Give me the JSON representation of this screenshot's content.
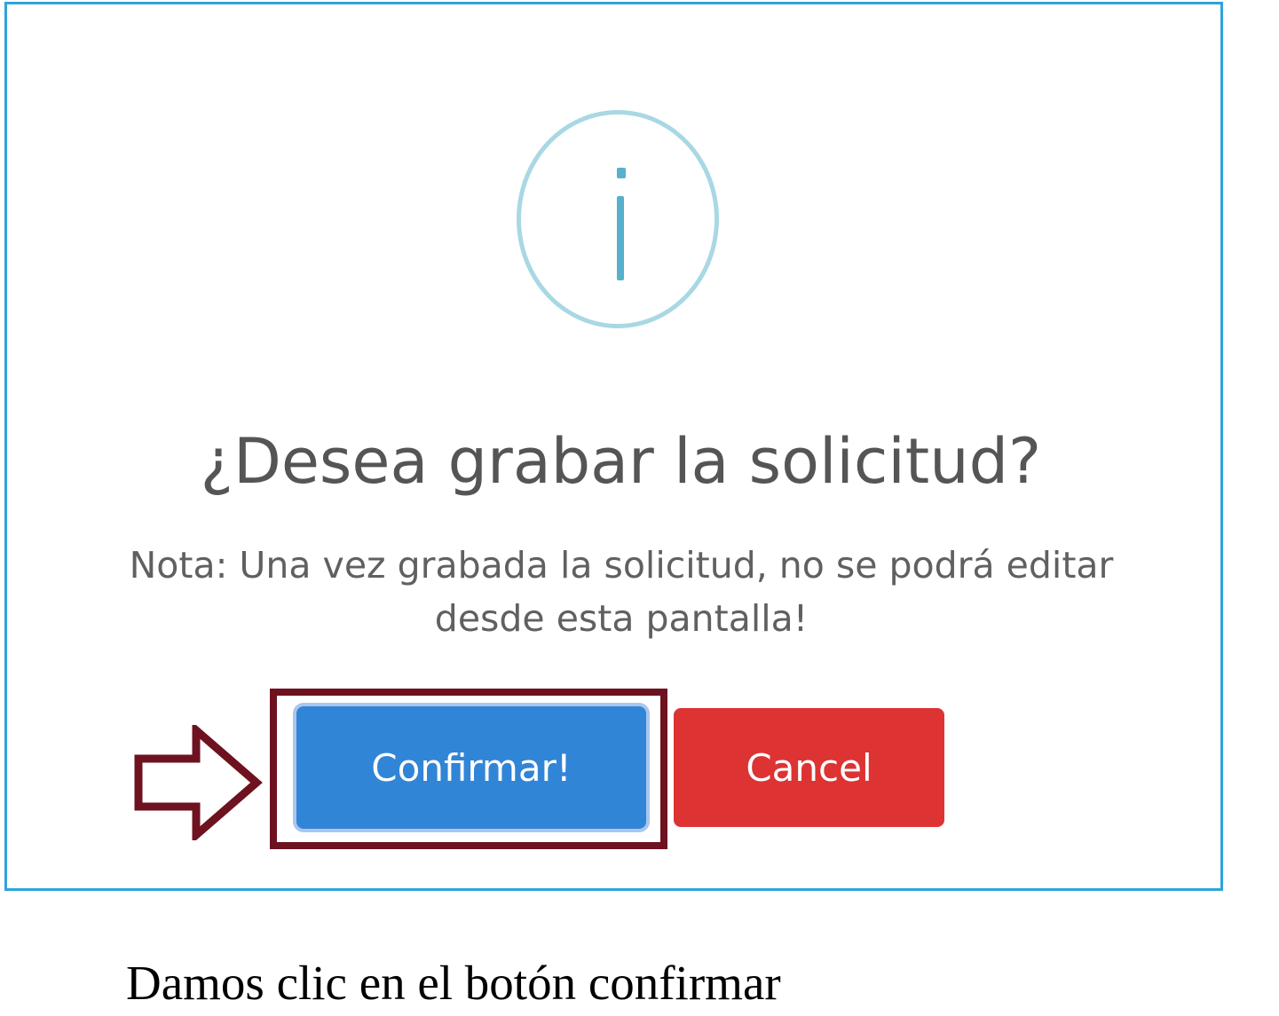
{
  "dialog": {
    "title": "¿Desea grabar la solicitud?",
    "note": "Nota: Una vez grabada la solicitud, no se podrá editar desde esta pantalla!",
    "icon": "info-icon",
    "confirm_label": "Confirmar!",
    "cancel_label": "Cancel"
  },
  "annotation": {
    "arrow_icon": "right-arrow-icon",
    "caption": "Damos clic en el botón confirmar"
  },
  "colors": {
    "frame_border": "#2ea3dc",
    "confirm_button": "#3185d6",
    "cancel_button": "#dd3333",
    "annotation": "#6e1220",
    "info_icon": "#57b0cc"
  }
}
